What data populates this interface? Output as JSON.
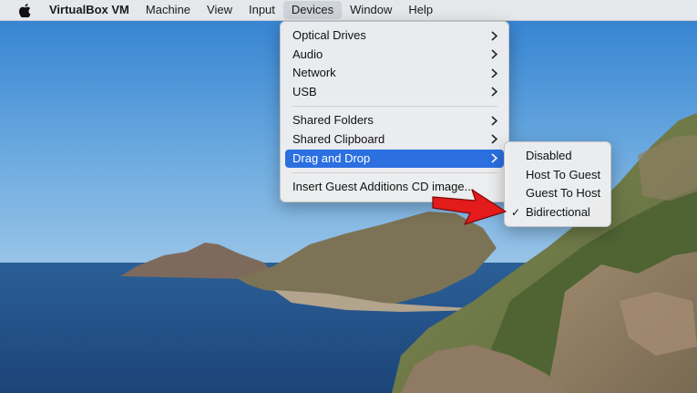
{
  "menubar": {
    "apple_icon": "apple-icon",
    "app_name": "VirtualBox VM",
    "items": [
      "Machine",
      "View",
      "Input",
      "Devices",
      "Window",
      "Help"
    ],
    "active_item": "Devices"
  },
  "devices_menu": {
    "group1": [
      "Optical Drives",
      "Audio",
      "Network",
      "USB"
    ],
    "group2": [
      "Shared Folders",
      "Shared Clipboard",
      "Drag and Drop"
    ],
    "group3": [
      "Insert Guest Additions CD image..."
    ],
    "highlighted": "Drag and Drop"
  },
  "drag_and_drop_menu": {
    "items": [
      "Disabled",
      "Host To Guest",
      "Guest To Host",
      "Bidirectional"
    ],
    "checked": "Bidirectional",
    "check_mark": "✓"
  },
  "colors": {
    "highlight": "#2b6fe0",
    "annotation_arrow": "#e31b1b"
  }
}
